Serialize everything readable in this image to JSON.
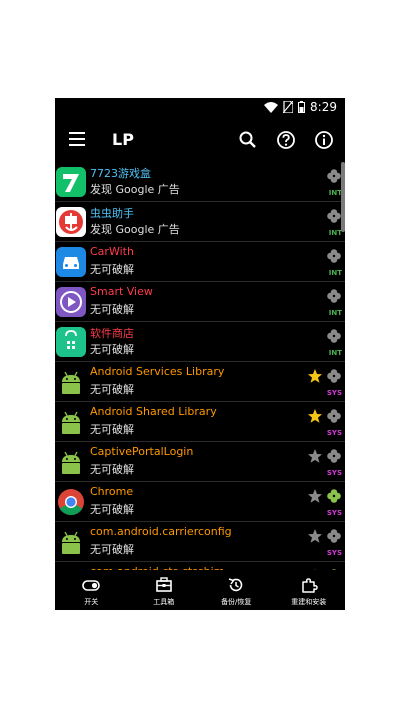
{
  "status_bar": {
    "time": "8:29"
  },
  "toolbar": {
    "title": "LP"
  },
  "apps": [
    {
      "name": "7723游戏盒",
      "subtitle": "发现 Google 广告",
      "name_color": "#4fc3f7",
      "tag": "INT",
      "star": "none",
      "clover": "grey",
      "icon": "seven-icon",
      "icon_bg": "#12c06a"
    },
    {
      "name": "虫虫助手",
      "subtitle": "发现 Google 广告",
      "name_color": "#4fc3f7",
      "tag": "INT",
      "star": "none",
      "clover": "grey",
      "icon": "chongchong-icon",
      "icon_bg": "#ffffff"
    },
    {
      "name": "CarWith",
      "subtitle": "无可破解",
      "name_color": "#ff3b4a",
      "tag": "INT",
      "star": "none",
      "clover": "grey",
      "icon": "car-icon",
      "icon_bg": "#1e88e5"
    },
    {
      "name": "Smart View",
      "subtitle": "无可破解",
      "name_color": "#ff3b4a",
      "tag": "INT",
      "star": "none",
      "clover": "grey",
      "icon": "play-icon",
      "icon_bg": "#7e57c2"
    },
    {
      "name": "软件商店",
      "subtitle": "无可破解",
      "name_color": "#ff3b4a",
      "tag": "INT",
      "star": "none",
      "clover": "grey",
      "icon": "store-icon",
      "icon_bg": "#1dc38a"
    },
    {
      "name": "Android Services Library",
      "subtitle": "无可破解",
      "name_color": "#ff9800",
      "tag": "SYS",
      "star": "gold",
      "clover": "grey",
      "icon": "android-icon",
      "icon_bg": "#8bc34a"
    },
    {
      "name": "Android Shared Library",
      "subtitle": "无可破解",
      "name_color": "#ff9800",
      "tag": "SYS",
      "star": "gold",
      "clover": "grey",
      "icon": "android-icon",
      "icon_bg": "#8bc34a"
    },
    {
      "name": "CaptivePortalLogin",
      "subtitle": "无可破解",
      "name_color": "#ff9800",
      "tag": "SYS",
      "star": "grey",
      "clover": "grey",
      "icon": "android-icon",
      "icon_bg": "#8bc34a"
    },
    {
      "name": "Chrome",
      "subtitle": "无可破解",
      "name_color": "#ff9800",
      "tag": "SYS",
      "star": "grey",
      "clover": "green",
      "icon": "chrome-icon",
      "icon_bg": "#ffffff"
    },
    {
      "name": "com.android.carrierconfig",
      "subtitle": "无可破解",
      "name_color": "#ff9800",
      "tag": "SYS",
      "star": "grey",
      "clover": "grey",
      "icon": "android-icon",
      "icon_bg": "#8bc34a"
    },
    {
      "name": "com.android.cts.ctsshim",
      "subtitle": "",
      "name_color": "#ff9800",
      "tag": "",
      "star": "grey",
      "clover": "green",
      "icon": "android-icon",
      "icon_bg": "#8bc34a"
    }
  ],
  "bottom_nav": [
    {
      "label": "开关",
      "icon": "toggle-icon"
    },
    {
      "label": "工具箱",
      "icon": "toolbox-icon"
    },
    {
      "label": "备份/恢复",
      "icon": "restore-icon"
    },
    {
      "label": "重建和安装",
      "icon": "puzzle-icon"
    }
  ],
  "colors": {
    "gold_star": "#f5c518",
    "grey_icon": "#8a8a8a",
    "green_clover": "#8bc34a"
  }
}
